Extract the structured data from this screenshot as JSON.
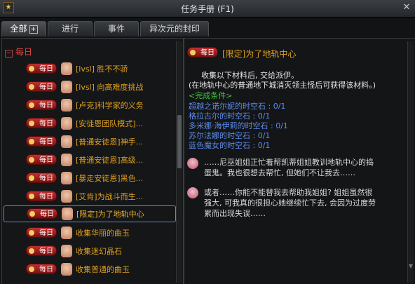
{
  "window": {
    "title": "任务手册 (F1)"
  },
  "tabs": [
    {
      "label": "全部",
      "plus": "+"
    },
    {
      "label": "进行"
    },
    {
      "label": "事件"
    },
    {
      "label": "异次元的封印"
    }
  ],
  "left": {
    "category": {
      "toggle": "−",
      "label": "每日"
    },
    "badge_label": "每日",
    "quests": [
      "[lvsl] 胜不不骄",
      "[lvsl] 向高难度挑战",
      "[卢克]科学家的义务",
      "[安徒恩团队模式]...",
      "[普通安徒恩]神手...",
      "[普通安徒恩]高级...",
      "[暴走安徒恩]黑色...",
      "[艾肯]为战斗而生...",
      "[限定]为了地轨中心",
      "收集华丽的曲玉",
      "收集迷幻晶石",
      "收集普通的曲玉"
    ]
  },
  "right": {
    "badge_label": "每日",
    "quest_title": "[限定]为了地轨中心",
    "desc1": "收集以下材料后, 交给派伊。",
    "desc2": "(在地轨中心的普通地下城消灭领主怪后可获得该材料。)",
    "cond_header": "<完成条件>",
    "conditions": [
      "超越之诺尔妮的时空石 : 0/1",
      "格拉古尔的时空石 : 0/1",
      "多米娜·海伊莉的时空石 : 0/1",
      "苏尔法娜的时空石 : 0/1",
      "蓝色魔女的时空石 : 0/1"
    ],
    "dialog1_l1": "……尼巫姐姐正忙着帮凯蒂姐姐教训地轨中心的捣",
    "dialog1_l2": "蛋鬼。我也很想去帮忙, 但她们不让我去……",
    "dialog2_l1": "或者……你能不能替我去帮助我姐姐? 姐姐虽然很",
    "dialog2_l2": "强大, 可我真的很担心她继续忙下去, 会因为过度劳",
    "dialog2_l3": "累而出现失误……"
  },
  "colors": {
    "accent": "#e0a020",
    "badge": "#c03030",
    "condition": "#5a8cf0",
    "header": "#40c040"
  }
}
